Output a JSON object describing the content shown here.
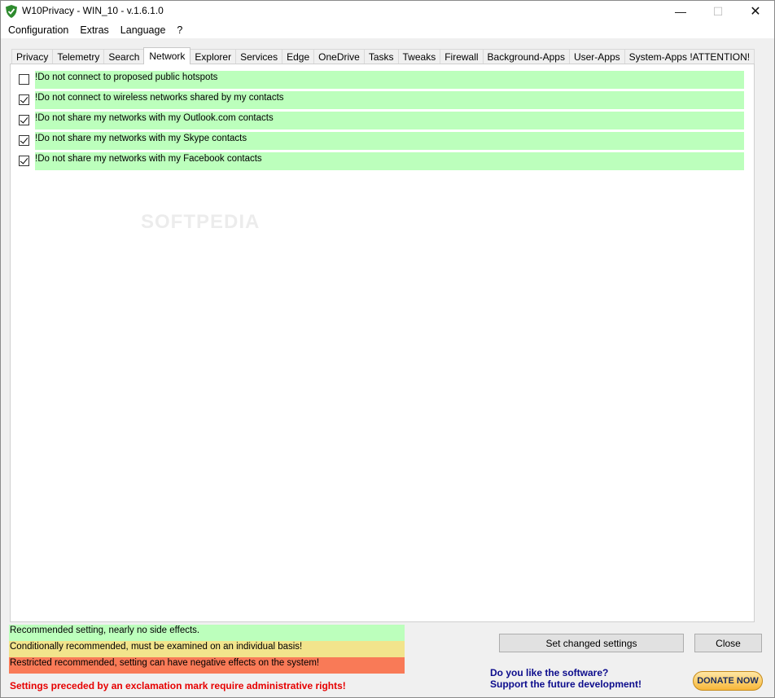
{
  "window": {
    "title": "W10Privacy - WIN_10 - v.1.6.1.0",
    "min_glyph": "—",
    "max_glyph": "☐",
    "close_glyph": "✕"
  },
  "menu": [
    "Configuration",
    "Extras",
    "Language",
    "?"
  ],
  "tabs": [
    {
      "label": "Privacy",
      "active": false
    },
    {
      "label": "Telemetry",
      "active": false
    },
    {
      "label": "Search",
      "active": false
    },
    {
      "label": "Network",
      "active": true
    },
    {
      "label": "Explorer",
      "active": false
    },
    {
      "label": "Services",
      "active": false
    },
    {
      "label": "Edge",
      "active": false
    },
    {
      "label": "OneDrive",
      "active": false
    },
    {
      "label": "Tasks",
      "active": false
    },
    {
      "label": "Tweaks",
      "active": false
    },
    {
      "label": "Firewall",
      "active": false
    },
    {
      "label": "Background-Apps",
      "active": false
    },
    {
      "label": "User-Apps",
      "active": false
    },
    {
      "label": "System-Apps !ATTENTION!",
      "active": false
    }
  ],
  "options": [
    {
      "label": "!Do not connect to proposed public hotspots",
      "checked": false
    },
    {
      "label": "!Do not connect to wireless networks shared by my contacts",
      "checked": true
    },
    {
      "label": "!Do not share my networks with my Outlook.com contacts",
      "checked": true
    },
    {
      "label": "!Do not share my networks with my Skype contacts",
      "checked": true
    },
    {
      "label": "!Do not share my networks with my Facebook contacts",
      "checked": true
    }
  ],
  "watermark": "SOFTPEDIA",
  "legend": {
    "green": "Recommended setting, nearly no side effects.",
    "yellow": "Conditionally recommended, must be examined on an individual basis!",
    "red": "Restricted recommended, setting can have negative effects on the system!"
  },
  "admin_note": "Settings preceded by an exclamation mark require administrative rights!",
  "buttons": {
    "set_changed": "Set changed settings",
    "close": "Close"
  },
  "donate": {
    "line1": "Do you like the software?",
    "line2": "Support the future development!",
    "button": "DONATE NOW"
  },
  "colors": {
    "recommended": "#bcffbc",
    "conditional": "#f2e48c",
    "restricted": "#f97a57",
    "admin_note": "#e60000",
    "donate_text": "#0c0c8c"
  }
}
